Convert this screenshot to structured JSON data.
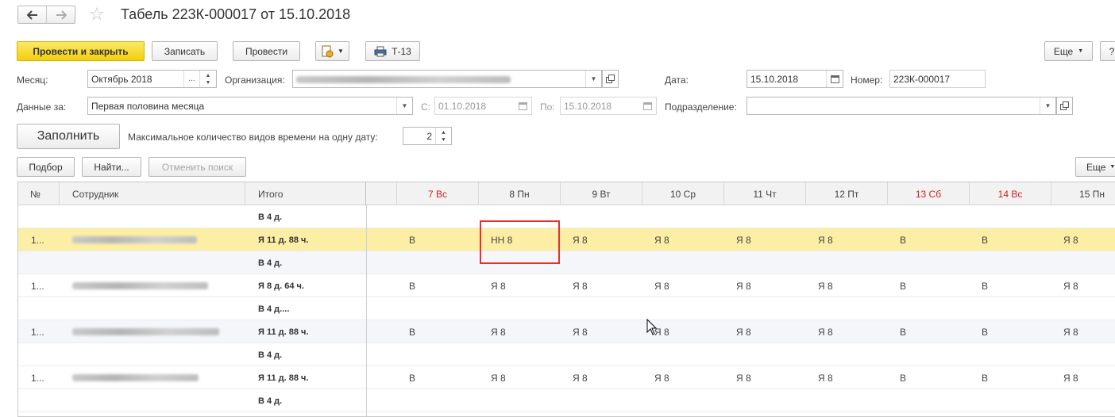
{
  "window": {
    "title": "Табель 223К-000017 от 15.10.2018",
    "nav_back_icon": "arrow-left-icon",
    "nav_forward_icon": "arrow-right-icon",
    "favorite_icon": "star-icon"
  },
  "toolbar": {
    "post_close": "Провести и закрыть",
    "save": "Записать",
    "post": "Провести",
    "print_label": "Т-13",
    "more": "Еще",
    "help": "?"
  },
  "form": {
    "month_label": "Месяц:",
    "month_value": "Октябрь 2018",
    "org_label": "Организация:",
    "date_label": "Дата:",
    "date_value": "15.10.2018",
    "number_label": "Номер:",
    "number_value": "223К-000017",
    "data_for_label": "Данные за:",
    "data_for_value": "Первая половина  месяца",
    "from_label": "С:",
    "from_value": "01.10.2018",
    "to_label": "По:",
    "to_value": "15.10.2018",
    "dept_label": "Подразделение:",
    "dept_value": "",
    "fill_button": "Заполнить",
    "max_types_label": "Максимальное количество видов времени на одну дату:",
    "max_types_value": "2"
  },
  "table_toolbar": {
    "select": "Подбор",
    "find": "Найти...",
    "cancel_search": "Отменить поиск",
    "more": "Еще"
  },
  "table": {
    "columns": {
      "num": "№",
      "employee": "Сотрудник",
      "total": "Итого"
    },
    "days": [
      {
        "label": "7 Вс",
        "weekend": true
      },
      {
        "label": "8 Пн",
        "weekend": false
      },
      {
        "label": "9 Вт",
        "weekend": false
      },
      {
        "label": "10 Ср",
        "weekend": false
      },
      {
        "label": "11 Чт",
        "weekend": false
      },
      {
        "label": "12 Пт",
        "weekend": false
      },
      {
        "label": "13 Сб",
        "weekend": true
      },
      {
        "label": "14 Вс",
        "weekend": true
      },
      {
        "label": "15 Пн",
        "weekend": false
      }
    ],
    "rows": [
      {
        "kind": "total",
        "total": "В 4 д.",
        "cells": [
          "",
          "",
          "",
          "",
          "",
          "",
          "",
          "",
          ""
        ]
      },
      {
        "kind": "main",
        "selected": true,
        "num": "1...",
        "total": "Я 11 д. 88 ч.",
        "cells": [
          "В",
          "НН 8",
          "Я 8",
          "Я 8",
          "Я 8",
          "Я 8",
          "В",
          "В",
          "Я 8"
        ]
      },
      {
        "kind": "total",
        "alt": true,
        "total": "В 4 д.",
        "cells": [
          "",
          "",
          "",
          "",
          "",
          "",
          "",
          "",
          ""
        ]
      },
      {
        "kind": "main",
        "num": "1...",
        "total": "Я 8 д. 64 ч.",
        "cells": [
          "В",
          "Я 8",
          "Я 8",
          "Я 8",
          "Я 8",
          "Я 8",
          "В",
          "В",
          "Я 8"
        ]
      },
      {
        "kind": "total",
        "total": "В 4 д....",
        "cells": [
          "",
          "",
          "",
          "",
          "",
          "",
          "",
          "",
          ""
        ]
      },
      {
        "kind": "main",
        "alt": true,
        "num": "1...",
        "total": "Я 11 д. 88 ч.",
        "cells": [
          "В",
          "Я 8",
          "Я 8",
          "Я 8",
          "Я 8",
          "Я 8",
          "В",
          "В",
          "Я 8"
        ]
      },
      {
        "kind": "total",
        "total": "В 4 д.",
        "cells": [
          "",
          "",
          "",
          "",
          "",
          "",
          "",
          "",
          ""
        ]
      },
      {
        "kind": "main",
        "num": "1...",
        "total": "Я 11 д. 88 ч.",
        "cells": [
          "В",
          "Я 8",
          "Я 8",
          "Я 8",
          "Я 8",
          "Я 8",
          "В",
          "В",
          "Я 8"
        ]
      },
      {
        "kind": "total",
        "total": "В 4 д.",
        "cells": [
          "",
          "",
          "",
          "",
          "",
          "",
          "",
          "",
          ""
        ]
      }
    ]
  },
  "colors": {
    "accent_yellow": "#f3cf0b",
    "selected_row": "#fcefa5",
    "weekend_red": "#d21f1f",
    "highlight_box": "#e53030"
  }
}
